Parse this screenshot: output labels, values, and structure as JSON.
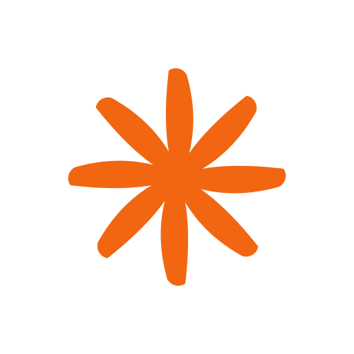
{
  "colors": {
    "background": "#ffffff",
    "accent": "#f26611"
  },
  "logo": {
    "icon": "pinwheel-icon",
    "petal_count": 8
  }
}
